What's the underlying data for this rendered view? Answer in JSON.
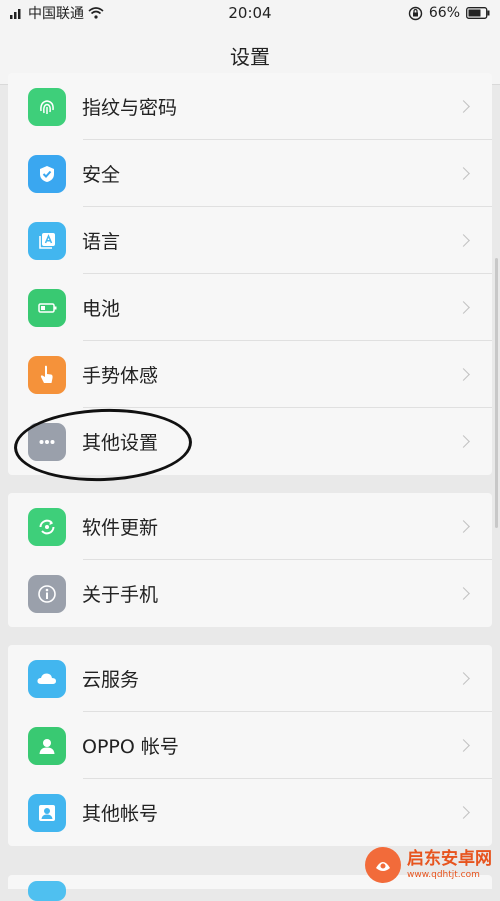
{
  "status_bar": {
    "carrier": "中国联通",
    "time": "20:04",
    "battery": "66%"
  },
  "header": {
    "title": "设置"
  },
  "groups": [
    {
      "items": [
        {
          "label": "指纹与密码",
          "icon": "fingerprint-icon",
          "color": "#3ecf7a"
        },
        {
          "label": "安全",
          "icon": "shield-icon",
          "color": "#3aa7f0"
        },
        {
          "label": "语言",
          "icon": "language-icon",
          "color": "#42b6ef"
        },
        {
          "label": "电池",
          "icon": "battery-icon",
          "color": "#39c972"
        },
        {
          "label": "手势体感",
          "icon": "gesture-icon",
          "color": "#f5923a"
        },
        {
          "label": "其他设置",
          "icon": "more-icon",
          "color": "#9aa0ab"
        }
      ]
    },
    {
      "items": [
        {
          "label": "软件更新",
          "icon": "update-icon",
          "color": "#3ecf7a"
        },
        {
          "label": "关于手机",
          "icon": "info-icon",
          "color": "#9aa0ab"
        }
      ]
    },
    {
      "items": [
        {
          "label": "云服务",
          "icon": "cloud-icon",
          "color": "#42b6ef"
        },
        {
          "label": "OPPO 帐号",
          "icon": "account-icon",
          "color": "#39c972"
        },
        {
          "label": "其他帐号",
          "icon": "accounts-icon",
          "color": "#42b6ef"
        }
      ]
    }
  ],
  "watermark": {
    "main": "启东安卓网",
    "sub": "www.qdhtjt.com"
  }
}
